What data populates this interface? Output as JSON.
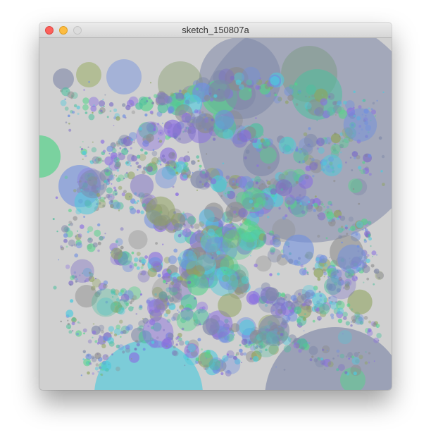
{
  "window": {
    "title": "sketch_150807a",
    "controls": {
      "close": "close-window-button",
      "minimize": "minimize-window-button",
      "zoom": "zoom-window-button"
    }
  },
  "sketch": {
    "background": "#d0d0d0",
    "palette": {
      "slate": "#7e87a8",
      "blue": "#6f8fe0",
      "cyan": "#4fc9dc",
      "green": "#55d38a",
      "teal": "#4fbf9e",
      "olive": "#8fa35e",
      "purple": "#7c6ec6",
      "violet": "#8a6fe0",
      "gray": "#8c8c8c"
    }
  }
}
